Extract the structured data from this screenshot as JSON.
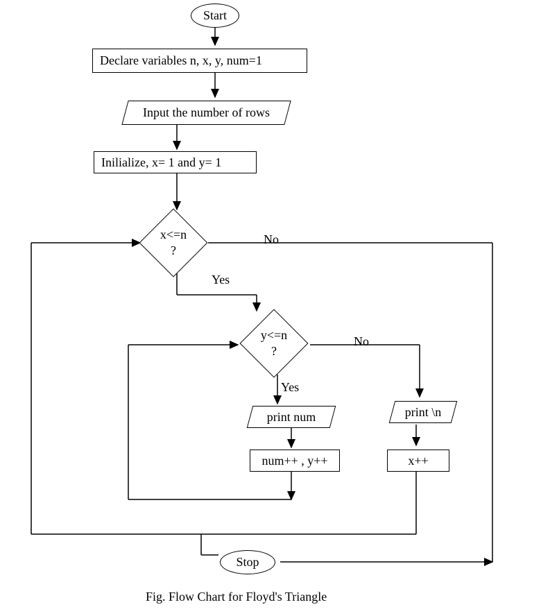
{
  "flowchart": {
    "start": "Start",
    "declare": "Declare variables n, x, y, num=1",
    "input": "Input the number of rows",
    "initialize": "Inilialize, x= 1 and y= 1",
    "decision1": "x<=n",
    "decision1_q": "?",
    "decision2": "y<=n",
    "decision2_q": "?",
    "print_num": "print num",
    "increment_num": "num++ , y++",
    "print_newline": "print \\n",
    "increment_x": "x++",
    "stop": "Stop",
    "yes": "Yes",
    "no": "No",
    "caption": "Fig. Flow Chart for Floyd's Triangle"
  }
}
